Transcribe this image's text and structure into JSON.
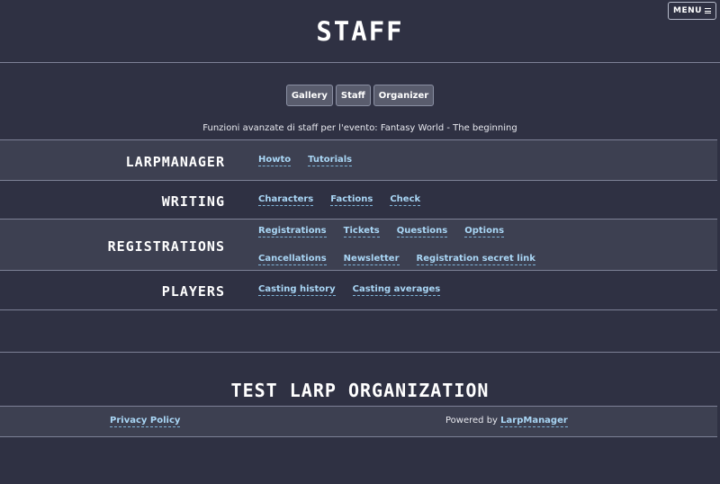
{
  "header": {
    "menu_label": "MENU",
    "title": "STAFF"
  },
  "tabs": [
    {
      "label": "Gallery"
    },
    {
      "label": "Staff"
    },
    {
      "label": "Organizer"
    }
  ],
  "intro": "Funzioni avanzate di staff per l'evento: Fantasy World - The beginning",
  "sections": [
    {
      "title": "LARPMANAGER",
      "links": [
        "Howto",
        "Tutorials"
      ]
    },
    {
      "title": "WRITING",
      "links": [
        "Characters",
        "Factions",
        "Check"
      ]
    },
    {
      "title": "REGISTRATIONS",
      "links_row1": [
        "Registrations",
        "Tickets",
        "Questions",
        "Options"
      ],
      "links_row2": [
        "Cancellations",
        "Newsletter",
        "Registration secret link"
      ]
    },
    {
      "title": "PLAYERS",
      "links": [
        "Casting history",
        "Casting averages"
      ]
    }
  ],
  "footer": {
    "org_title": "TEST LARP ORGANIZATION",
    "privacy": "Privacy Policy",
    "powered_prefix": "Powered by",
    "powered_link": "LarpManager"
  }
}
